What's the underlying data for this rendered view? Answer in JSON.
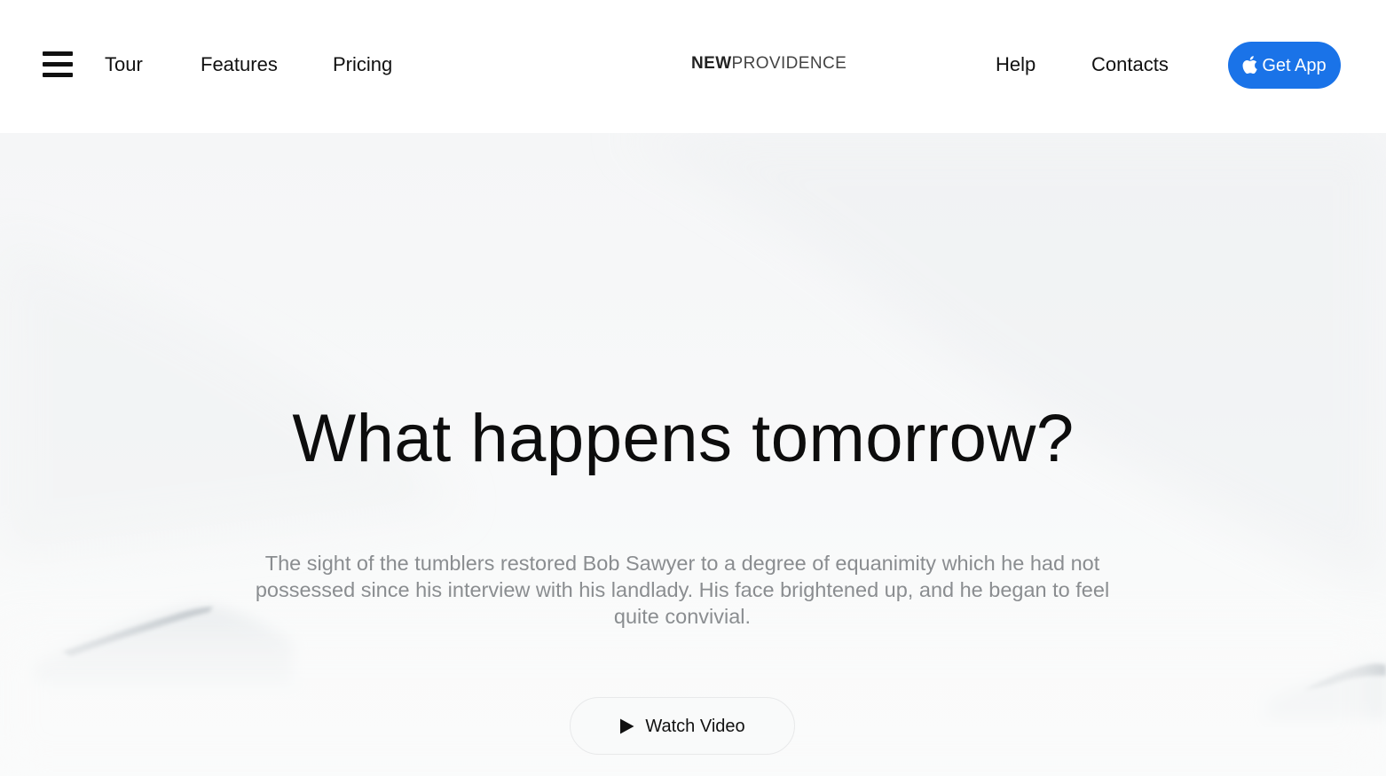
{
  "header": {
    "menu_icon": "hamburger-menu-icon",
    "nav_left": [
      {
        "label": "Tour"
      },
      {
        "label": "Features"
      },
      {
        "label": "Pricing"
      }
    ],
    "logo": {
      "bold": "NEW",
      "light": "PROVIDENCE"
    },
    "nav_right": [
      {
        "label": "Help"
      },
      {
        "label": "Contacts"
      }
    ],
    "cta": {
      "label": "Get App",
      "icon": "apple-icon",
      "color": "#1a73e8"
    }
  },
  "hero": {
    "title": "What happens tomorrow?",
    "text": "The sight of the tumblers restored Bob Sawyer to a degree of equanimity which he had not possessed since his interview with his landlady. His face brightened up, and he began to feel quite convivial.",
    "video_button": {
      "label": "Watch Video",
      "icon": "play-icon"
    }
  }
}
